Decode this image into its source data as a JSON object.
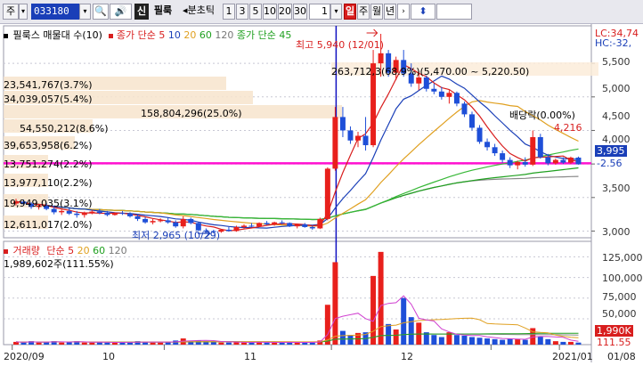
{
  "toolbar": {
    "market_prefix": "주",
    "stock_code": "033180",
    "credit_badge": "신",
    "stock_name": "필룩",
    "period_prefix": "분초틱",
    "periods": [
      "1",
      "3",
      "5",
      "10",
      "20",
      "30"
    ],
    "period_count": "1",
    "active_period": "일",
    "other_periods": [
      "주",
      "월",
      "년"
    ],
    "colors": {
      "active": "#d81e1e",
      "code_bg": "#1a3fb8"
    }
  },
  "price_panel": {
    "legend_name": "필룩스 매물대 수(10)",
    "legend_ma": "종가 단순",
    "legend_ma_values": [
      "5",
      "10",
      "20",
      "60",
      "120"
    ],
    "legend_ma_extra": "종가 단순 45",
    "lc_label": "LC:34,74",
    "hc_label": "HC:-32,",
    "high_annotation": "최고 5,940 (12/01)",
    "low_annotation": "최저 2,965 (10/29)",
    "dividend_annotation": "배당락(0.00%)",
    "dividend_price": "4,216",
    "current_price": "3,995",
    "change_pct": "-2.56",
    "y_ticks": [
      "5,500",
      "5,000",
      "4,500",
      "4,000",
      "3,500",
      "3,000"
    ],
    "volume_at_price": [
      {
        "label": "263,712,3(68.9%)(5,470.00 ~ 5,220.50)",
        "highlight": false
      },
      {
        "label": "23,541,767(3.7%)",
        "highlight": true
      },
      {
        "label": "34,039,057(5.4%)",
        "highlight": true
      },
      {
        "label": "158,804,296(25.0%)",
        "highlight": true
      },
      {
        "label": "54,550,212(8.6%)",
        "highlight": true
      },
      {
        "label": "39,653,958(6.2%)",
        "highlight": true
      },
      {
        "label": "13,751,274(2.2%)",
        "highlight": false
      },
      {
        "label": "13,977,110(2.2%)",
        "highlight": false
      },
      {
        "label": "19,949,035(3.1%)",
        "highlight": false
      },
      {
        "label": "12,611,017(2.0%)",
        "highlight": false
      }
    ]
  },
  "volume_panel": {
    "legend_name": "거래량",
    "legend_ma": "단순",
    "legend_ma_values": [
      "5",
      "20",
      "60",
      "120"
    ],
    "volume_summary": "1,989,602주(111.55%)",
    "y_ticks": [
      "125,000",
      "100,000",
      "75,000",
      "50,000"
    ],
    "last_volume_tag": "1,990K",
    "last_pct_tag": "111.55"
  },
  "x_axis": {
    "labels": [
      "2020/09",
      "10",
      "11",
      "12",
      "2021/01",
      "01/08"
    ]
  },
  "chart_data": {
    "type": "candlestick",
    "y_range": [
      2900,
      5900
    ],
    "candles": [
      [
        3410,
        3480,
        3380,
        3440
      ],
      [
        3440,
        3470,
        3380,
        3410
      ],
      [
        3410,
        3430,
        3330,
        3360
      ],
      [
        3360,
        3400,
        3320,
        3380
      ],
      [
        3380,
        3420,
        3310,
        3330
      ],
      [
        3330,
        3380,
        3250,
        3280
      ],
      [
        3280,
        3320,
        3240,
        3300
      ],
      [
        3300,
        3340,
        3240,
        3260
      ],
      [
        3260,
        3300,
        3200,
        3240
      ],
      [
        3240,
        3290,
        3200,
        3270
      ],
      [
        3270,
        3310,
        3250,
        3290
      ],
      [
        3290,
        3330,
        3250,
        3270
      ],
      [
        3270,
        3300,
        3220,
        3240
      ],
      [
        3240,
        3280,
        3230,
        3270
      ],
      [
        3270,
        3300,
        3240,
        3260
      ],
      [
        3260,
        3280,
        3200,
        3220
      ],
      [
        3220,
        3250,
        3150,
        3180
      ],
      [
        3180,
        3210,
        3110,
        3130
      ],
      [
        3130,
        3180,
        3100,
        3150
      ],
      [
        3150,
        3190,
        3130,
        3160
      ],
      [
        3160,
        3200,
        3110,
        3130
      ],
      [
        3130,
        3160,
        3050,
        3070
      ],
      [
        3070,
        3220,
        3040,
        3180
      ],
      [
        3180,
        3200,
        3100,
        3120
      ],
      [
        3120,
        3130,
        3000,
        3010
      ],
      [
        3010,
        3040,
        2970,
        3000
      ],
      [
        3000,
        3020,
        2965,
        2990
      ],
      [
        2990,
        3030,
        2975,
        3020
      ],
      [
        3020,
        3060,
        2990,
        3000
      ],
      [
        3000,
        3080,
        2990,
        3060
      ],
      [
        3060,
        3100,
        3040,
        3080
      ],
      [
        3080,
        3120,
        3060,
        3070
      ],
      [
        3070,
        3130,
        3060,
        3120
      ],
      [
        3120,
        3150,
        3090,
        3100
      ],
      [
        3100,
        3140,
        3080,
        3130
      ],
      [
        3130,
        3160,
        3100,
        3120
      ],
      [
        3120,
        3130,
        3060,
        3070
      ],
      [
        3070,
        3110,
        3040,
        3100
      ],
      [
        3100,
        3120,
        3050,
        3060
      ],
      [
        3060,
        3080,
        3020,
        3040
      ],
      [
        3040,
        3200,
        3030,
        3180
      ],
      [
        3180,
        3950,
        3160,
        3930
      ],
      [
        3930,
        4850,
        3900,
        4700
      ],
      [
        4700,
        4850,
        4400,
        4500
      ],
      [
        4500,
        4560,
        4300,
        4350
      ],
      [
        4350,
        4480,
        4250,
        4420
      ],
      [
        4420,
        4700,
        4200,
        4280
      ],
      [
        4280,
        5700,
        4250,
        5500
      ],
      [
        5500,
        5940,
        5300,
        5650
      ],
      [
        5650,
        5700,
        5300,
        5360
      ],
      [
        5360,
        5600,
        5250,
        5550
      ],
      [
        5550,
        5700,
        5300,
        5350
      ],
      [
        5350,
        5500,
        5150,
        5200
      ],
      [
        5200,
        5380,
        5100,
        5290
      ],
      [
        5290,
        5320,
        5080,
        5120
      ],
      [
        5120,
        5200,
        5040,
        5080
      ],
      [
        5080,
        5150,
        4960,
        5000
      ],
      [
        5000,
        5100,
        4900,
        5060
      ],
      [
        5060,
        5080,
        4860,
        4900
      ],
      [
        4900,
        4930,
        4700,
        4740
      ],
      [
        4740,
        4780,
        4500,
        4540
      ],
      [
        4540,
        4580,
        4300,
        4330
      ],
      [
        4330,
        4380,
        4200,
        4250
      ],
      [
        4250,
        4300,
        4120,
        4160
      ],
      [
        4160,
        4200,
        4020,
        4060
      ],
      [
        4060,
        4100,
        3940,
        3980
      ],
      [
        3980,
        4050,
        3920,
        4030
      ],
      [
        4030,
        4100,
        3960,
        3990
      ],
      [
        3990,
        4500,
        3970,
        4400
      ],
      [
        4400,
        4450,
        4080,
        4100
      ],
      [
        4100,
        4150,
        3980,
        4010
      ],
      [
        4010,
        4080,
        3990,
        4060
      ],
      [
        4060,
        4100,
        4000,
        4020
      ],
      [
        4020,
        4110,
        4000,
        4095
      ],
      [
        4095,
        4110,
        3990,
        3995
      ]
    ],
    "volumes": [
      4,
      3,
      5,
      3,
      4,
      5,
      3,
      4,
      5,
      3,
      3,
      4,
      3,
      3,
      3,
      4,
      5,
      4,
      3,
      3,
      4,
      6,
      9,
      5,
      6,
      5,
      4,
      3,
      3,
      4,
      3,
      3,
      4,
      3,
      3,
      3,
      4,
      3,
      3,
      3,
      6,
      58,
      120,
      20,
      14,
      17,
      18,
      100,
      135,
      30,
      22,
      68,
      40,
      32,
      18,
      14,
      11,
      18,
      14,
      13,
      11,
      10,
      9,
      8,
      7,
      9,
      8,
      7,
      24,
      12,
      8,
      5,
      4,
      4,
      3
    ],
    "grid": true
  }
}
